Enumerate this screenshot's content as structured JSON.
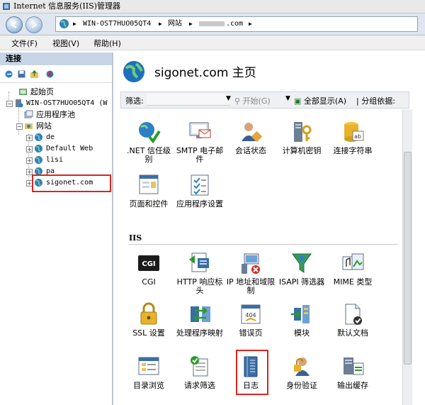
{
  "window": {
    "title": "Internet 信息服务(IIS)管理器"
  },
  "address": {
    "server": "WIN-OST7HUO05QT4",
    "sites": "网站",
    "site_suffix": ".com"
  },
  "menu": {
    "file": "文件(F)",
    "view": "视图(V)",
    "help": "帮助(H)"
  },
  "connections": {
    "header": "连接",
    "tree": {
      "start_page": "起始页",
      "server": "WIN-OST7HUO05QT4 (W",
      "app_pools": "应用程序池",
      "sites": "网站",
      "site_de": "de",
      "site_default": "Default Web",
      "site_lisi": "lisi",
      "site_pa": "pa",
      "site_sigonet": "sigonet.com"
    }
  },
  "main": {
    "title": "sigonet.com 主页",
    "filter": {
      "label": "筛选:",
      "start": "开始(G)",
      "show_all": "全部显示(A)",
      "group_by": "分组依据:"
    },
    "features_top": [
      {
        "label": ".NET 信任级别",
        "icon": "net-trust-icon"
      },
      {
        "label": "SMTP 电子邮件",
        "icon": "smtp-email-icon"
      },
      {
        "label": "会话状态",
        "icon": "session-state-icon"
      },
      {
        "label": "计算机密钥",
        "icon": "machine-key-icon"
      },
      {
        "label": "连接字符串",
        "icon": "connection-strings-icon"
      },
      {
        "label": "页面和控件",
        "icon": "pages-controls-icon"
      },
      {
        "label": "应用程序设置",
        "icon": "app-settings-icon"
      }
    ],
    "iis_section": "IIS",
    "features_iis": [
      {
        "label": "CGI",
        "icon": "cgi-icon"
      },
      {
        "label": "HTTP 响应标头",
        "icon": "http-headers-icon"
      },
      {
        "label": "IP 地址和域限制",
        "icon": "ip-restrictions-icon"
      },
      {
        "label": "ISAPI 筛选器",
        "icon": "isapi-filters-icon"
      },
      {
        "label": "MIME 类型",
        "icon": "mime-types-icon"
      },
      {
        "label": "SSL 设置",
        "icon": "ssl-settings-icon"
      },
      {
        "label": "处理程序映射",
        "icon": "handler-mappings-icon"
      },
      {
        "label": "错误页",
        "icon": "error-pages-icon"
      },
      {
        "label": "模块",
        "icon": "modules-icon"
      },
      {
        "label": "默认文档",
        "icon": "default-document-icon"
      },
      {
        "label": "目录浏览",
        "icon": "directory-browsing-icon"
      },
      {
        "label": "请求筛选",
        "icon": "request-filtering-icon"
      },
      {
        "label": "日志",
        "icon": "logging-icon"
      },
      {
        "label": "身份验证",
        "icon": "authentication-icon"
      },
      {
        "label": "输出缓存",
        "icon": "output-caching-icon"
      }
    ]
  },
  "colors": {
    "highlight": "#d8261f",
    "header_bg": "#c7d5e6"
  }
}
